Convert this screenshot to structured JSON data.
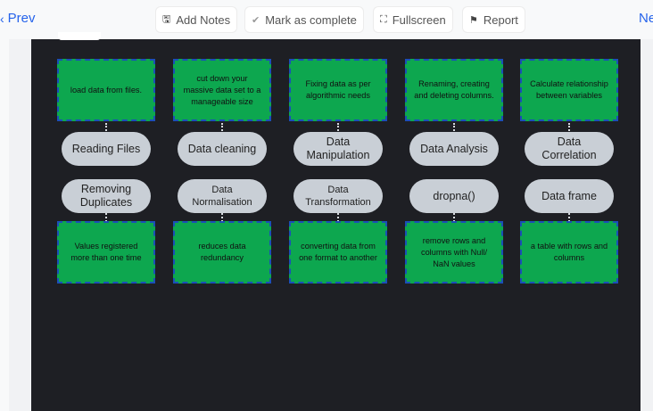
{
  "nav": {
    "prev_label": "Prev",
    "next_label": "Ne"
  },
  "toolbar": {
    "add_notes": "Add Notes",
    "mark_complete": "Mark as complete",
    "fullscreen": "Fullscreen",
    "report": "Report"
  },
  "diagram": {
    "top_notes": [
      "load data from files.",
      "cut down your massive data set to a manageable size",
      "Fixing data as per algorithmic needs",
      "Renaming, creating and deleting columns.",
      "Calculate relationship between variables"
    ],
    "top_pills": [
      "Reading Files",
      "Data cleaning",
      "Data Manipulation",
      "Data Analysis",
      "Data Correlation"
    ],
    "bottom_pills": [
      "Removing Duplicates",
      "Data Normalisation",
      "Data Transformation",
      "dropna()",
      "Data frame"
    ],
    "bottom_notes": [
      "Values registered more than one time",
      "reduces data redundancy",
      "converting data from one format to another",
      "remove rows and columns with Null/ NaN values",
      "a table with rows and columns"
    ]
  }
}
